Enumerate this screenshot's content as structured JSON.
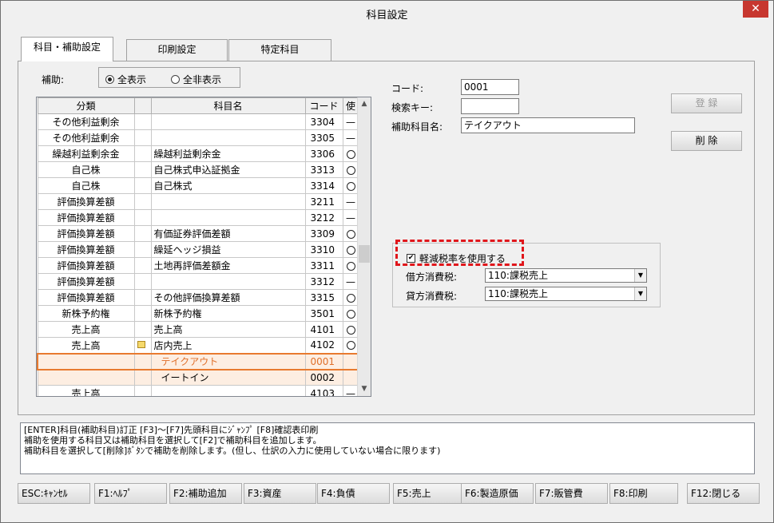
{
  "window": {
    "title": "科目設定",
    "close_glyph": "✕"
  },
  "tabs": [
    {
      "label": "科目・補助設定",
      "active": true
    },
    {
      "label": "印刷設定",
      "active": false
    },
    {
      "label": "特定科目",
      "active": false
    }
  ],
  "filter": {
    "label": "補助:",
    "options": [
      {
        "label": "全表示",
        "selected": true
      },
      {
        "label": "全非表示",
        "selected": false
      }
    ]
  },
  "grid": {
    "columns": [
      "分類",
      "",
      "科目名",
      "コード",
      "使"
    ],
    "rows": [
      {
        "category": "その他利益剰余",
        "icon": "",
        "name": "",
        "code": "3304",
        "use": "dash",
        "type": "normal"
      },
      {
        "category": "その他利益剰余",
        "icon": "",
        "name": "",
        "code": "3305",
        "use": "dash",
        "type": "normal"
      },
      {
        "category": "繰越利益剰余金",
        "icon": "",
        "name": "繰越利益剰余金",
        "code": "3306",
        "use": "circle",
        "type": "normal"
      },
      {
        "category": "自己株",
        "icon": "",
        "name": "自己株式申込証拠金",
        "code": "3313",
        "use": "circle",
        "type": "normal"
      },
      {
        "category": "自己株",
        "icon": "",
        "name": "自己株式",
        "code": "3314",
        "use": "circle",
        "type": "normal"
      },
      {
        "category": "評価換算差額",
        "icon": "",
        "name": "",
        "code": "3211",
        "use": "dash",
        "type": "normal"
      },
      {
        "category": "評価換算差額",
        "icon": "",
        "name": "",
        "code": "3212",
        "use": "dash",
        "type": "normal"
      },
      {
        "category": "評価換算差額",
        "icon": "",
        "name": "有価証券評価差額",
        "code": "3309",
        "use": "circle",
        "type": "normal"
      },
      {
        "category": "評価換算差額",
        "icon": "",
        "name": "繰延ヘッジ損益",
        "code": "3310",
        "use": "circle",
        "type": "normal"
      },
      {
        "category": "評価換算差額",
        "icon": "",
        "name": "土地再評価差額金",
        "code": "3311",
        "use": "circle",
        "type": "normal"
      },
      {
        "category": "評価換算差額",
        "icon": "",
        "name": "",
        "code": "3312",
        "use": "dash",
        "type": "normal"
      },
      {
        "category": "評価換算差額",
        "icon": "",
        "name": "その他評価換算差額",
        "code": "3315",
        "use": "circle",
        "type": "normal"
      },
      {
        "category": "新株予約権",
        "icon": "",
        "name": "新株予約権",
        "code": "3501",
        "use": "circle",
        "type": "normal"
      },
      {
        "category": "売上高",
        "icon": "",
        "name": "売上高",
        "code": "4101",
        "use": "circle",
        "type": "normal"
      },
      {
        "category": "売上高",
        "icon": "folder",
        "name": "店内売上",
        "code": "4102",
        "use": "circle",
        "type": "normal"
      },
      {
        "category": "",
        "icon": "",
        "name": "テイクアウト",
        "code": "0001",
        "use": "",
        "type": "sel"
      },
      {
        "category": "",
        "icon": "",
        "name": "イートイン",
        "code": "0002",
        "use": "",
        "type": "sub"
      },
      {
        "category": "売上高",
        "icon": "",
        "name": "",
        "code": "4103",
        "use": "dash",
        "type": "normal"
      }
    ],
    "use_dash_glyph": "—",
    "scroll_up": "▲",
    "scroll_down": "▼"
  },
  "form": {
    "code_label": "コード:",
    "code_value": "0001",
    "search_label": "検索キー:",
    "search_value": "",
    "name_label": "補助科目名:",
    "name_value": "テイクアウト",
    "register_label": "登 録",
    "delete_label": "削 除"
  },
  "tax": {
    "reduced_rate_label": "軽減税率を使用する",
    "reduced_rate_checked": true,
    "check_glyph": "✔",
    "debit_label": "借方消費税:",
    "debit_value": "110:課税売上",
    "credit_label": "貸方消費税:",
    "credit_value": "110:課税売上",
    "dropdown_glyph": "▼"
  },
  "message": {
    "line1": "[ENTER]科目(補助科目)訂正 [F3]～[F7]先頭科目にｼﾞｬﾝﾌﾟ [F8]確認表印刷",
    "line2": "補助を使用する科目又は補助科目を選択して[F2]で補助科目を追加します。",
    "line3": "補助科目を選択して[削除]ﾎﾞﾀﾝで補助を削除します。(但し、仕訳の入力に使用していない場合に限ります)"
  },
  "fkeys": [
    "ESC:ｷｬﾝｾﾙ",
    "F1:ﾍﾙﾌﾟ",
    "F2:補助追加",
    "F3:資産",
    "F4:負債",
    "F5:売上",
    "F6:製造原価",
    "F7:販管費",
    "F8:印刷",
    "F12:閉じる"
  ]
}
